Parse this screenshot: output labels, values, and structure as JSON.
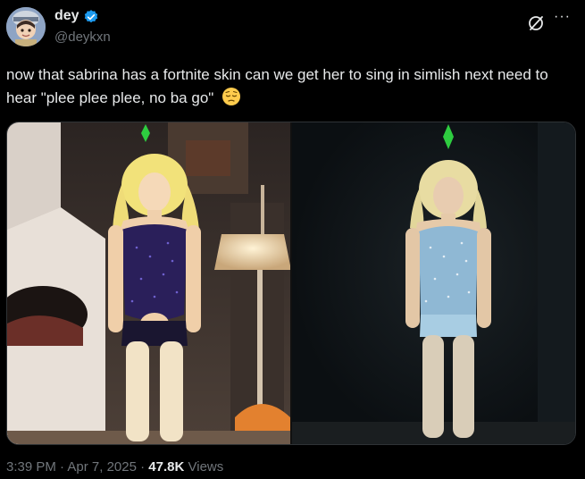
{
  "author": {
    "display_name": "dey",
    "handle": "@deykxn"
  },
  "tweet": {
    "text": "now that sabrina has a fortnite skin can we get her to sing in simlish next need to hear \"plee plee plee, no ba go\"",
    "emoji": "pensive-face-emoji"
  },
  "meta": {
    "time": "3:39 PM",
    "separator": "·",
    "date": "Apr 7, 2025",
    "views_count": "47.8K",
    "views_label": "Views"
  },
  "icons": {
    "verified": "verified-badge-icon",
    "grok": "grok-icon",
    "more": "more-options-icon"
  },
  "colors": {
    "background": "#000000",
    "text": "#e7e9ea",
    "muted": "#71767b",
    "verified_blue": "#1d9bf0",
    "sims_plumbob": "#2ecc40"
  }
}
